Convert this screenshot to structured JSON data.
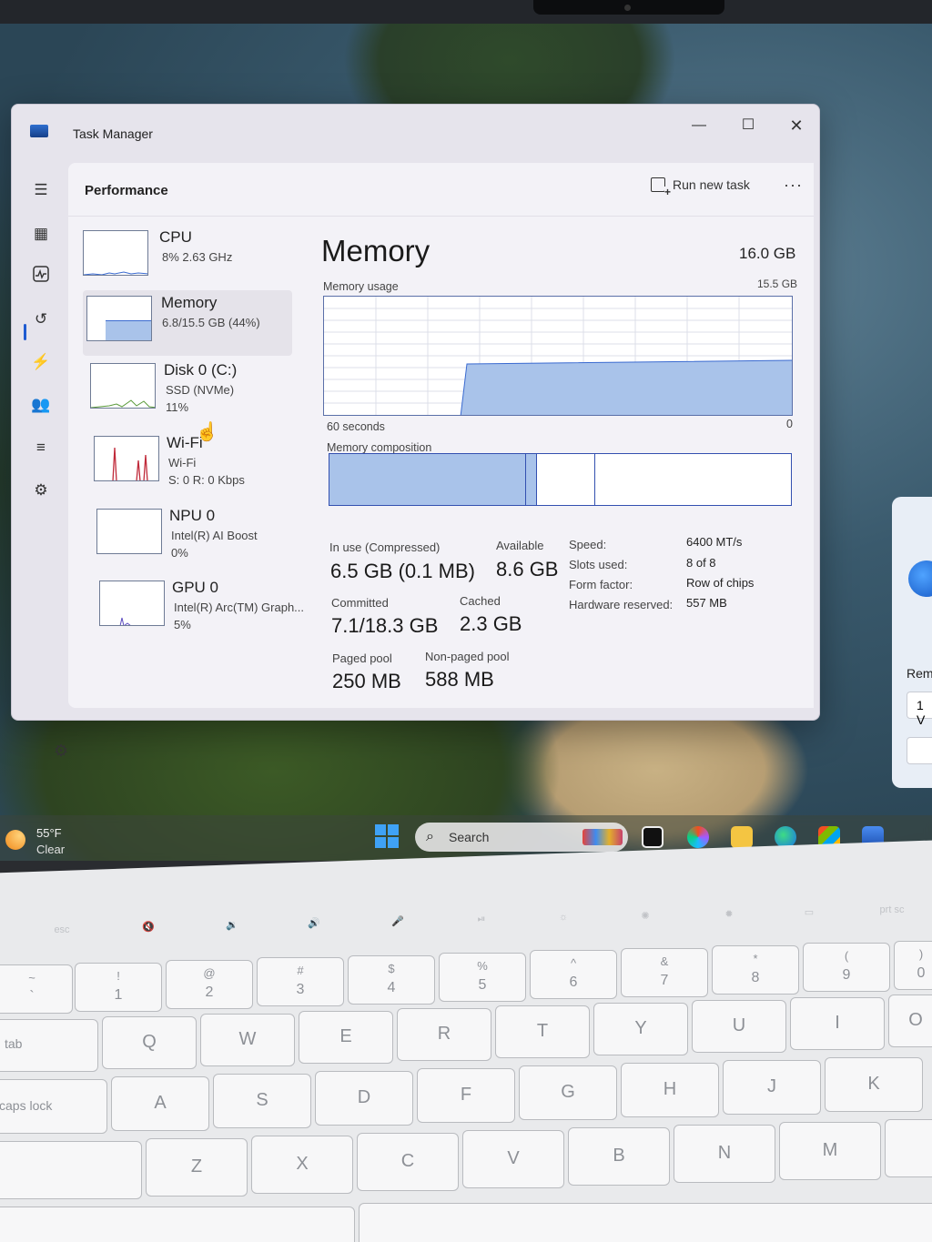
{
  "window": {
    "title": "Task Manager",
    "minimize": "—",
    "maximize": "☐",
    "close": "✕"
  },
  "header": {
    "section": "Performance",
    "run_task": "Run new task",
    "more": "···"
  },
  "nav": [
    "menu-icon",
    "processes-icon",
    "performance-icon",
    "app-history-icon",
    "startup-apps-icon",
    "users-icon",
    "details-icon",
    "services-icon",
    "settings-icon"
  ],
  "devices": [
    {
      "name": "CPU",
      "sub": "8%  2.63 GHz",
      "sub2": ""
    },
    {
      "name": "Memory",
      "sub": "6.8/15.5 GB (44%)",
      "sub2": ""
    },
    {
      "name": "Disk 0 (C:)",
      "sub": "SSD (NVMe)",
      "sub2": "11%"
    },
    {
      "name": "Wi-Fi",
      "sub": "Wi-Fi",
      "sub2": "S: 0  R: 0 Kbps"
    },
    {
      "name": "NPU 0",
      "sub": "Intel(R) AI Boost",
      "sub2": "0%"
    },
    {
      "name": "GPU 0",
      "sub": "Intel(R) Arc(TM) Graph...",
      "sub2": "5%"
    }
  ],
  "memory": {
    "title": "Memory",
    "total": "16.0 GB",
    "usage_label": "Memory usage",
    "usage_max": "15.5 GB",
    "time_label": "60 seconds",
    "min_label": "0",
    "composition_label": "Memory composition",
    "in_use_label": "In use (Compressed)",
    "in_use_value": "6.5 GB (0.1 MB)",
    "available_label": "Available",
    "available_value": "8.6 GB",
    "committed_label": "Committed",
    "committed_value": "7.1/18.3 GB",
    "cached_label": "Cached",
    "cached_value": "2.3 GB",
    "paged_label": "Paged pool",
    "paged_value": "250 MB",
    "nonpaged_label": "Non-paged pool",
    "nonpaged_value": "588 MB",
    "specs": [
      {
        "label": "Speed:",
        "value": "6400 MT/s"
      },
      {
        "label": "Slots used:",
        "value": "8 of 8"
      },
      {
        "label": "Form factor:",
        "value": "Row of chips"
      },
      {
        "label": "Hardware reserved:",
        "value": "557 MB"
      }
    ]
  },
  "side_panel": {
    "text": "Rem",
    "box": "1 V"
  },
  "taskbar": {
    "temp": "55°F",
    "condition": "Clear",
    "search_placeholder": "Search"
  },
  "keyboard": {
    "fn_row": [
      "esc",
      "🔇",
      "🔉",
      "🔊",
      "🎤",
      "⏯",
      "☼",
      "✺",
      "✹",
      "▭",
      "prt sc"
    ],
    "num_row": [
      [
        "~",
        "`"
      ],
      [
        "!",
        "1"
      ],
      [
        "@",
        "2"
      ],
      [
        "#",
        "3"
      ],
      [
        "$",
        "4"
      ],
      [
        "%",
        "5"
      ],
      [
        "^",
        "6"
      ],
      [
        "&",
        "7"
      ],
      [
        "*",
        "8"
      ],
      [
        "(",
        "9"
      ],
      [
        ")",
        "0"
      ]
    ],
    "q_row": [
      "tab",
      "Q",
      "W",
      "E",
      "R",
      "T",
      "Y",
      "U",
      "I",
      "O"
    ],
    "a_row": [
      "caps lock",
      "A",
      "S",
      "D",
      "F",
      "G",
      "H",
      "J",
      "K"
    ],
    "z_row": [
      "",
      "Z",
      "X",
      "C",
      "V",
      "B",
      "N",
      "M"
    ]
  }
}
